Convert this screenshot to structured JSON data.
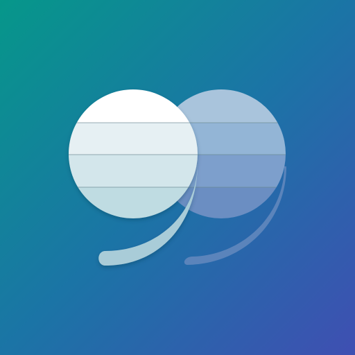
{
  "icon": {
    "name": "quotation-mark-icon",
    "shape": "closing double quotation mark",
    "background_gradient": [
      "#06978A",
      "#1B74A6",
      "#3F4FB2"
    ],
    "left_mark_colors": [
      "#FFFFFF",
      "#E6F0F3",
      "#D3E6EB",
      "#BFDCE2",
      "#A9CCD8"
    ],
    "right_mark_colors": [
      "#A9C4DC",
      "#93B5D6",
      "#7D9FCC",
      "#6B8EC2",
      "#5B84BB"
    ],
    "divider_color": "#6C8892"
  }
}
